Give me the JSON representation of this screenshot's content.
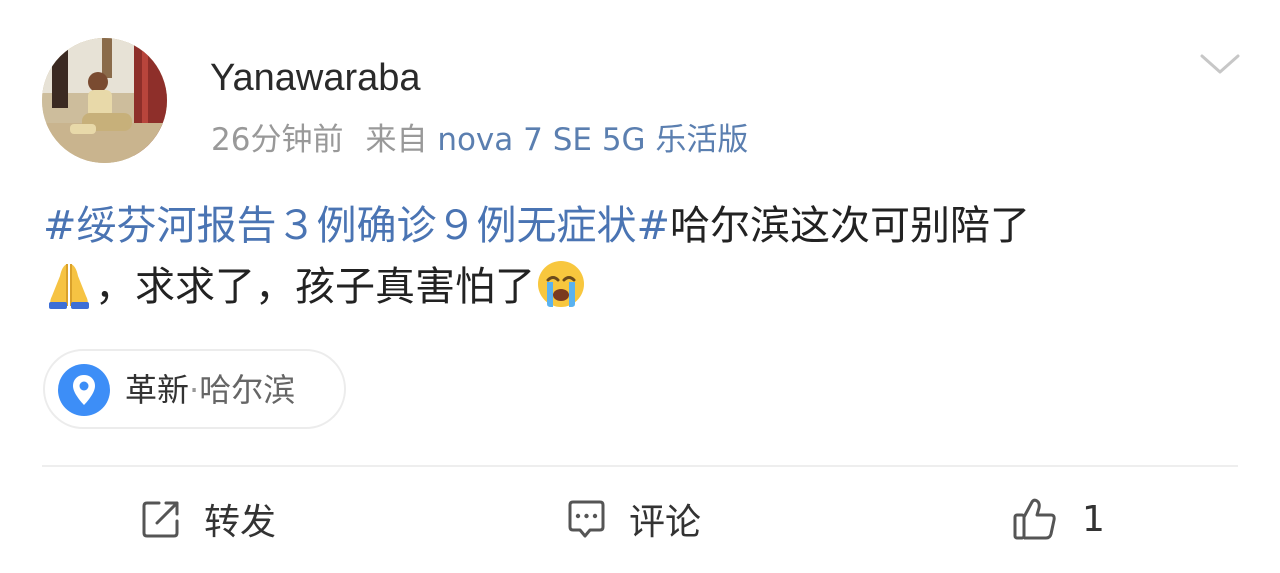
{
  "post": {
    "username": "Yanawaraba",
    "time": "26分钟前",
    "source_prefix": "来自",
    "device": "nova 7 SE 5G 乐活版",
    "topic": "#绥芬河报告３例确诊９例无症状#",
    "text_part1": "哈尔滨这次可别陪了",
    "text_part2": "，求求了，孩子真害怕了",
    "emoji_1": "folded-hands-emoji",
    "emoji_2": "loudly-crying-face-emoji"
  },
  "location": {
    "district": "革新",
    "separator": "·",
    "city": "哈尔滨",
    "icon": "location-pin-icon"
  },
  "actions": {
    "repost_label": "转发",
    "comment_label": "评论",
    "like_count": "1",
    "repost_icon": "repost-icon",
    "comment_icon": "comment-icon",
    "like_icon": "thumbs-up-icon"
  },
  "colors": {
    "topic_link": "#4a74b3",
    "device_link": "#5b7fb0",
    "meta_gray": "#999999",
    "pin_blue": "#3d8ef7"
  }
}
